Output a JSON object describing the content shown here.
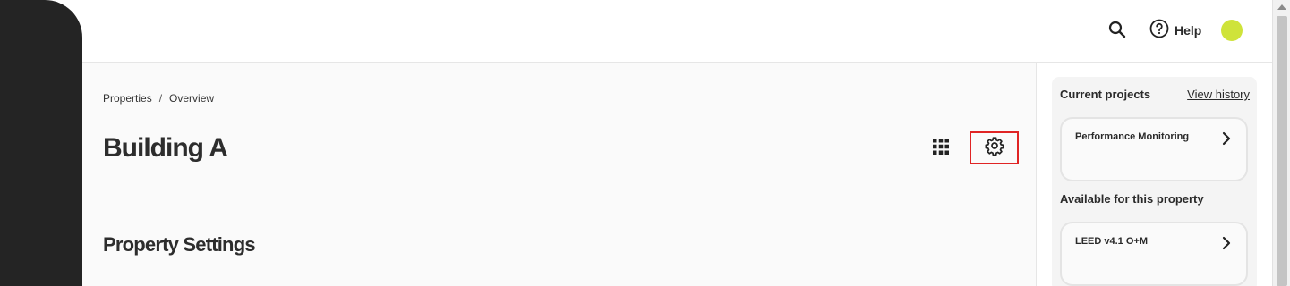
{
  "topbar": {
    "search_icon": "search-icon",
    "help_icon": "help-circle-icon",
    "help_label": "Help",
    "avatar_color": "#cfe33a"
  },
  "breadcrumb": {
    "items": [
      "Properties",
      "Overview"
    ],
    "separator": "/"
  },
  "main": {
    "title": "Building A",
    "section_title": "Property Settings",
    "grid_icon": "grid-icon",
    "settings_icon": "gear-icon",
    "highlight_color": "#e02424"
  },
  "right_panel": {
    "current_label": "Current projects",
    "history_link": "View history",
    "current_projects": [
      {
        "title": "Performance Monitoring"
      }
    ],
    "available_label": "Available for this property",
    "available_projects": [
      {
        "title": "LEED v4.1 O+M"
      }
    ]
  }
}
